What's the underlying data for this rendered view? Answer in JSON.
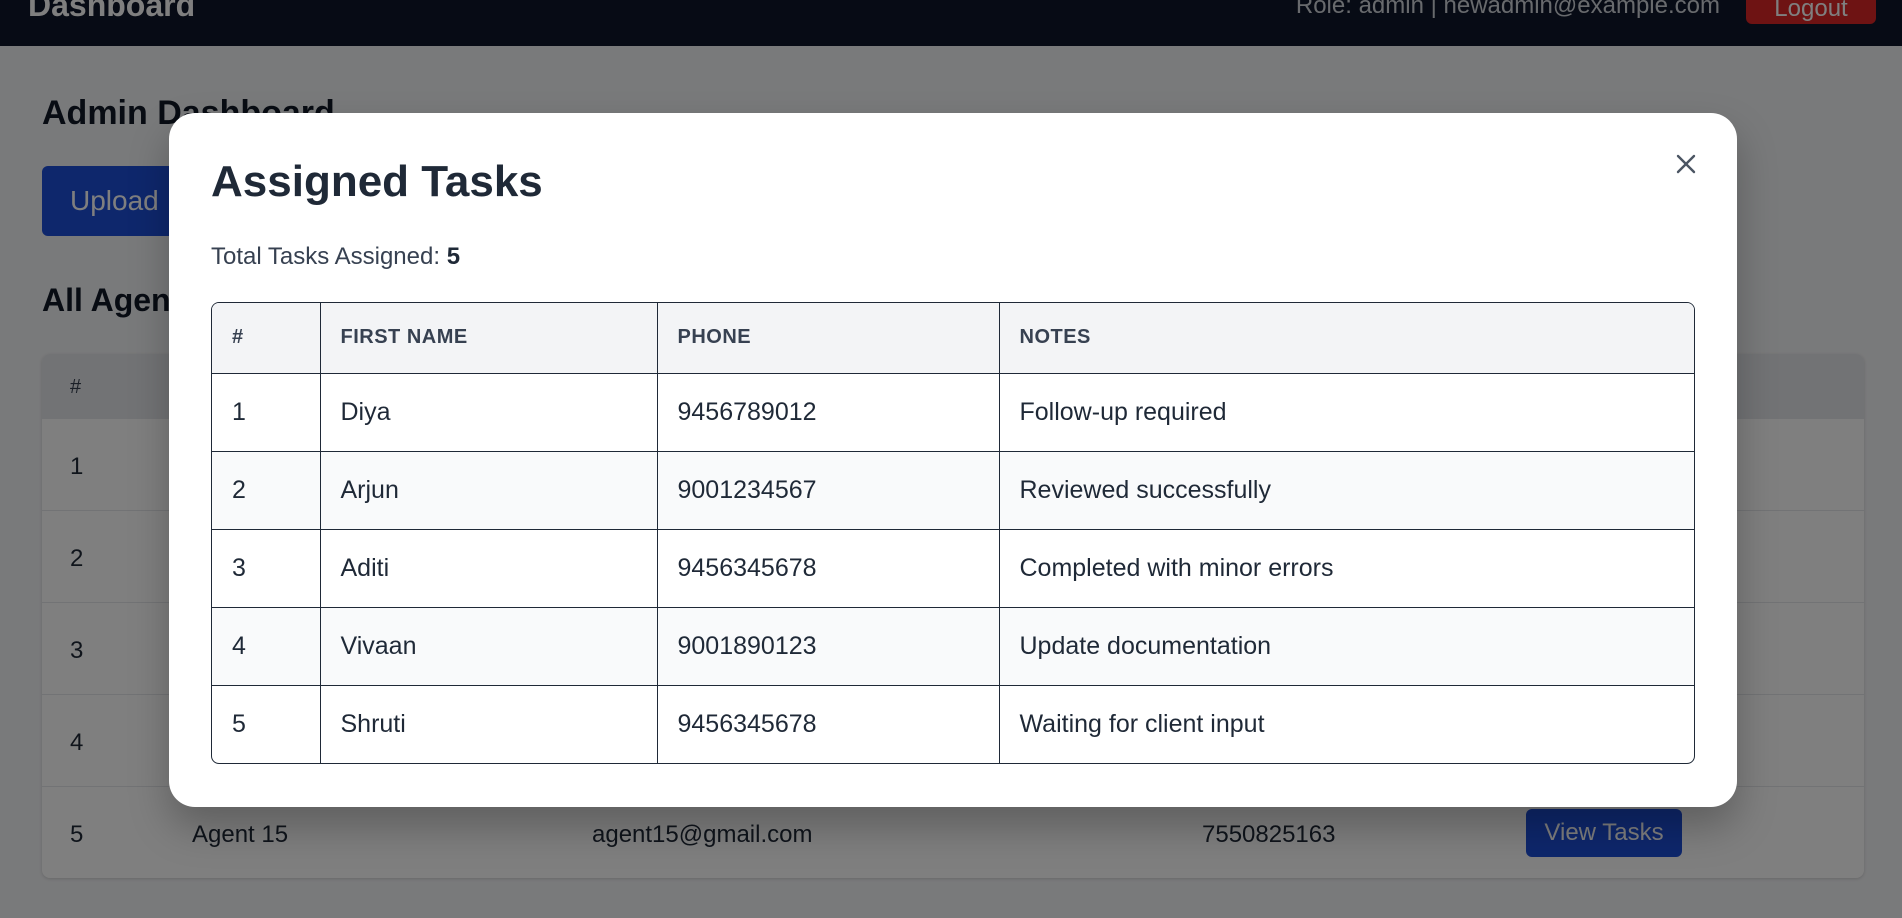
{
  "header": {
    "brand": "Dashboard",
    "user_info": "Role: admin | newadmin@example.com",
    "logout_label": "Logout"
  },
  "page": {
    "title": "Admin Dashboard",
    "upload_label": "Upload",
    "section_title": "All Agents"
  },
  "agents_table": {
    "index_header": "#",
    "rows": [
      {
        "index": "1",
        "name": "",
        "email": "",
        "phone": "",
        "action": ""
      },
      {
        "index": "2",
        "name": "",
        "email": "",
        "phone": "",
        "action": ""
      },
      {
        "index": "3",
        "name": "",
        "email": "",
        "phone": "",
        "action": ""
      },
      {
        "index": "4",
        "name": "",
        "email": "",
        "phone": "",
        "action": ""
      },
      {
        "index": "5",
        "name": "Agent 15",
        "email": "agent15@gmail.com",
        "phone": "7550825163",
        "action": "View Tasks"
      }
    ]
  },
  "modal": {
    "title": "Assigned Tasks",
    "total_label": "Total Tasks Assigned:",
    "total_value": "5",
    "columns": [
      "#",
      "FIRST NAME",
      "PHONE",
      "NOTES"
    ],
    "rows": [
      {
        "index": "1",
        "first_name": "Diya",
        "phone": "9456789012",
        "notes": "Follow-up required"
      },
      {
        "index": "2",
        "first_name": "Arjun",
        "phone": "9001234567",
        "notes": "Reviewed successfully"
      },
      {
        "index": "3",
        "first_name": "Aditi",
        "phone": "9456345678",
        "notes": "Completed with minor errors"
      },
      {
        "index": "4",
        "first_name": "Vivaan",
        "phone": "9001890123",
        "notes": "Update documentation"
      },
      {
        "index": "5",
        "first_name": "Shruti",
        "phone": "9456345678",
        "notes": "Waiting for client input"
      }
    ]
  },
  "icons": {
    "close": "close-icon"
  },
  "colors": {
    "topbar": "#0f172a",
    "primary": "#1d4ed8",
    "danger": "#dc2626",
    "overlay": "rgba(0,0,0,0.5)"
  }
}
